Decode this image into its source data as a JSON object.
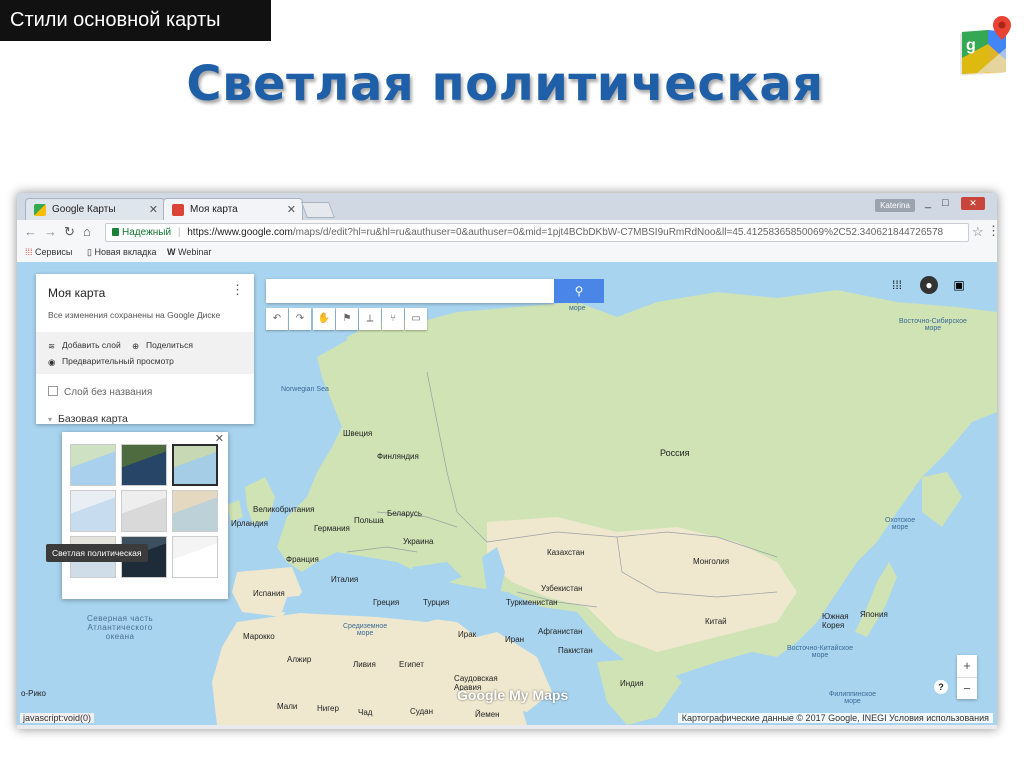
{
  "slide": {
    "tag": "Стили основной карты",
    "title": "Светлая политическая"
  },
  "browser": {
    "tabs": [
      {
        "label": "Google Карты",
        "icon": "google-maps-favicon"
      },
      {
        "label": "Моя карта",
        "icon": "my-maps-favicon"
      }
    ],
    "user_label": "Katerina",
    "window_controls": [
      "_",
      "□",
      "✕"
    ],
    "secure_label": "Надежный",
    "url_host": "https://www.google.com",
    "url_path": "/maps/d/edit?hl=ru&hl=ru&authuser=0&authuser=0&mid=1pjt4BCbDKbW-C7MBSI9uRmRdNoo&ll=45.41258365850069%2C52.340621844726578",
    "bookmarks": [
      {
        "label": "Сервисы",
        "icon": "apps-grid-icon"
      },
      {
        "label": "Новая вкладка",
        "icon": "page-icon"
      },
      {
        "label": "Webinar",
        "icon": "webinar-w-icon"
      }
    ],
    "status_left": "javascript:void(0)",
    "status_right": "Картографические данные © 2017 Google, INEGI   Условия использования"
  },
  "panel": {
    "title": "Моя карта",
    "subtitle": "Все изменения сохранены на Google Диске",
    "actions": {
      "add_layer": "Добавить слой",
      "share": "Поделиться",
      "preview": "Предварительный просмотр"
    },
    "layer_name": "Слой без названия",
    "base_map": "Базовая карта"
  },
  "styles_popup": {
    "tooltip": "Светлая политическая",
    "selected_index": 0,
    "thumbnails": [
      "map",
      "satellite",
      "terrain",
      "light-political",
      "monochrome",
      "simple-atlas",
      "light-landmass",
      "dark-landmass",
      "whitewater"
    ]
  },
  "map": {
    "brand": "Google My Maps",
    "labels": {
      "norwegian_sea": "Norwegian Sea",
      "barents_sea": "Баренцево\nморе",
      "kara_sea": "Карское\nморе",
      "east_siberian_sea": "Восточно-Сибирское\nморе",
      "okhotsk_sea": "Охотское\nморе",
      "north_atlantic": "Северная часть\nАтлантического\nокеана",
      "mediterranean": "Средиземное\nморе",
      "east_china_sea": "Восточно-Китайское\nморе",
      "philippine_sea": "Филиппинское\nморе",
      "sweden": "Швеция",
      "finland": "Финляндия",
      "ireland": "Ирландия",
      "uk": "Великобритания",
      "germany": "Германия",
      "poland": "Польша",
      "belarus": "Беларусь",
      "ukraine": "Украина",
      "france": "Франция",
      "spain": "Испания",
      "italy": "Италия",
      "greece": "Греция",
      "turkey": "Турция",
      "russia": "Россия",
      "kazakhstan": "Казахстан",
      "mongolia": "Монголия",
      "china": "Китай",
      "south_korea": "Южная\nКорея",
      "japan": "Япония",
      "turkmenistan": "Туркменистан",
      "uzbekistan": "Узбекистан",
      "iraq": "Ирак",
      "iran": "Иран",
      "afghanistan": "Афганистан",
      "pakistan": "Пакистан",
      "india": "Индия",
      "algeria": "Алжир",
      "libya": "Ливия",
      "egypt": "Египет",
      "saudi_arabia": "Саудовская\nАравия",
      "sudan": "Судан",
      "yemen": "Йемен",
      "mali": "Мали",
      "niger": "Нигер",
      "chad": "Чад",
      "morocco": "Марокко",
      "rio_de_oro": "о-Рико"
    },
    "zoom_in": "+",
    "zoom_out": "−",
    "help": "?"
  },
  "colors": {
    "title_blue": "#1f5fa8",
    "water": "#a8d4f0",
    "land_green": "#cfe3b5",
    "land_sand": "#efe8cf",
    "search_blue": "#4a86e8"
  }
}
